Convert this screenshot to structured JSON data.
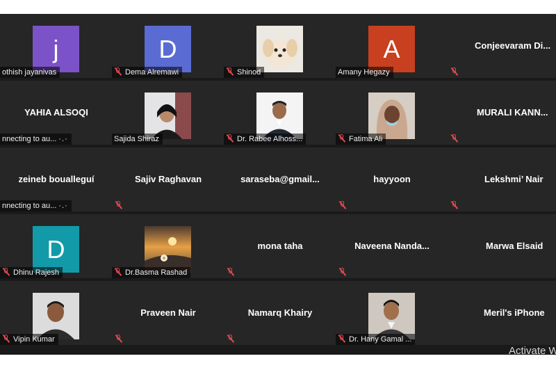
{
  "row1": [
    {
      "label": "othish jayanivas",
      "avatar": "j",
      "color": "#7b52c7"
    },
    {
      "label": "Dema Alremawi",
      "avatar": "D",
      "color": "#5b6bd4"
    },
    {
      "label": "Shinod",
      "avatar_icon": "puppy-photo"
    },
    {
      "label": "Amany Hegazy",
      "avatar": "A",
      "color": "#c8401f"
    },
    {
      "center": "Conjeevaram  Di..."
    }
  ],
  "row2": [
    {
      "center": "YAHIA ALSOQI",
      "label": "nnecting to au...",
      "status_icon": "loading-dots-icon",
      "dots": "·.·"
    },
    {
      "label": "Sajida Shiraz",
      "avatar_icon": "person-photo"
    },
    {
      "label": "Dr. Rabee Alhoss...",
      "avatar_icon": "person-photo"
    },
    {
      "label": "Fatima Ali",
      "avatar_icon": "person-photo"
    },
    {
      "center": "MURALI KANN..."
    }
  ],
  "row3": [
    {
      "center": "zeineb boualleguí",
      "label": "nnecting to au...",
      "dots": "·.·"
    },
    {
      "center": "Sajiv Raghavan"
    },
    {
      "center": "saraseba@gmail..."
    },
    {
      "center": "hayyoon"
    },
    {
      "center": "Lekshmi’ Nair"
    }
  ],
  "row4": [
    {
      "label": "Dhinu Rajesh",
      "avatar": "D",
      "color": "#139aa8"
    },
    {
      "label": "Dr.Basma Rashad",
      "avatar_icon": "sunset-photo"
    },
    {
      "center": "mona taha"
    },
    {
      "center": "Naveena  Nanda..."
    },
    {
      "center": "Marwa Elsaid"
    }
  ],
  "row5": [
    {
      "label": "Vipin Kumar",
      "avatar_icon": "person-photo"
    },
    {
      "center": "Praveen Nair"
    },
    {
      "center": "Namarq Khairy"
    },
    {
      "label": "Dr. Hany Gamal ...",
      "avatar_icon": "person-photo"
    },
    {
      "center": "Meril's iPhone"
    }
  ],
  "watermark": "Activate W"
}
